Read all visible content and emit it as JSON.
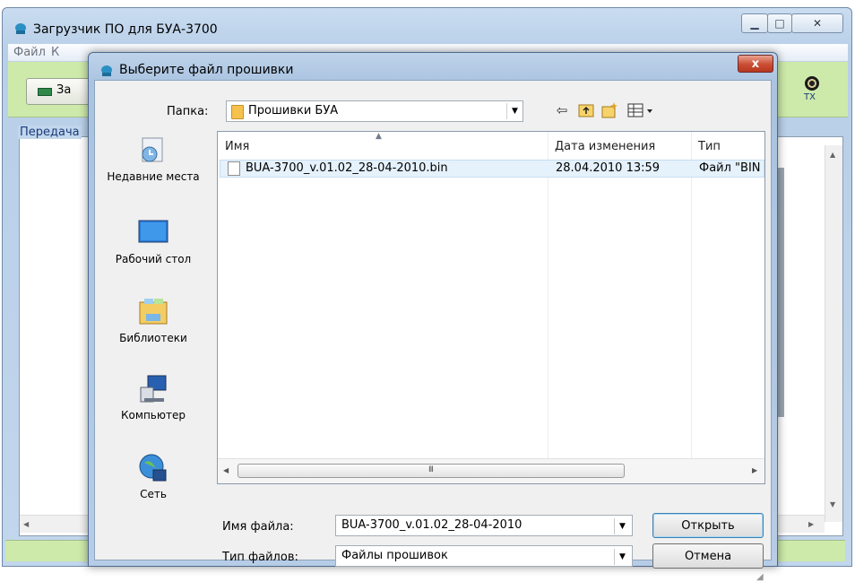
{
  "main_window": {
    "title": "Загрузчик ПО для БУА-3700",
    "menu": [
      "Файл",
      "К"
    ],
    "toolbar_button_label": "За",
    "tx_label": "TX",
    "transfer_group_label": "Передача"
  },
  "dialog": {
    "title": "Выберите файл прошивки",
    "close_label": "x",
    "folder_label": "Папка:",
    "folder_value": "Прошивки БУА",
    "places": [
      {
        "label": "Недавние места",
        "icon": "recent-places-icon"
      },
      {
        "label": "Рабочий стол",
        "icon": "desktop-icon"
      },
      {
        "label": "Библиотеки",
        "icon": "libraries-icon"
      },
      {
        "label": "Компьютер",
        "icon": "computer-icon"
      },
      {
        "label": "Сеть",
        "icon": "network-icon"
      }
    ],
    "columns": {
      "name": "Имя",
      "date": "Дата изменения",
      "type": "Тип"
    },
    "files": [
      {
        "name": "BUA-3700_v.01.02_28-04-2010.bin",
        "date": "28.04.2010 13:59",
        "type": "Файл \"BIN"
      }
    ],
    "scroll_grip": "III",
    "filename_label": "Имя файла:",
    "filename_value": "BUA-3700_v.01.02_28-04-2010",
    "filetype_label": "Тип файлов:",
    "filetype_value": "Файлы прошивок",
    "open_button": "Открыть",
    "cancel_button": "Отмена"
  },
  "colors": {
    "accent_green": "#cdeaaa",
    "window_frame": "#b8cfe8",
    "close_red": "#c94d33",
    "selection": "#e5f1fb"
  }
}
